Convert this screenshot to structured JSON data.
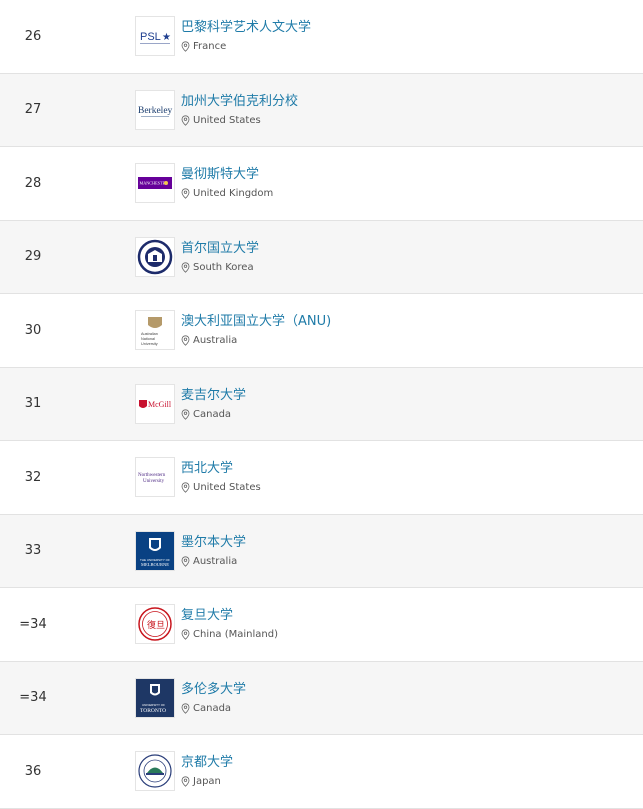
{
  "universities": [
    {
      "rank": "26",
      "name": "巴黎科学艺术人文大学",
      "country": "France",
      "logo": "psl-logo",
      "logo_text": "PSL★"
    },
    {
      "rank": "27",
      "name": "加州大学伯克利分校",
      "country": "United States",
      "logo": "berkeley-logo",
      "logo_text": "Berkeley"
    },
    {
      "rank": "28",
      "name": "曼彻斯特大学",
      "country": "United Kingdom",
      "logo": "manchester-logo",
      "logo_text": "MANCHESTER"
    },
    {
      "rank": "29",
      "name": "首尔国立大学",
      "country": "South Korea",
      "logo": "snu-logo",
      "logo_text": ""
    },
    {
      "rank": "30",
      "name": "澳大利亚国立大学（ANU)",
      "country": "Australia",
      "logo": "anu-logo",
      "logo_text": "Australian National University"
    },
    {
      "rank": "31",
      "name": "麦吉尔大学",
      "country": "Canada",
      "logo": "mcgill-logo",
      "logo_text": "McGill"
    },
    {
      "rank": "32",
      "name": "西北大学",
      "country": "United States",
      "logo": "northwestern-logo",
      "logo_text": "Northwestern University"
    },
    {
      "rank": "33",
      "name": "墨尔本大学",
      "country": "Australia",
      "logo": "melbourne-logo",
      "logo_text": "MELBOURNE"
    },
    {
      "rank": "=34",
      "name": "复旦大学",
      "country": "China (Mainland)",
      "logo": "fudan-logo",
      "logo_text": "复旦"
    },
    {
      "rank": "=34",
      "name": "多伦多大学",
      "country": "Canada",
      "logo": "toronto-logo",
      "logo_text": "TORONTO"
    },
    {
      "rank": "36",
      "name": "京都大学",
      "country": "Japan",
      "logo": "kyoto-logo",
      "logo_text": ""
    }
  ],
  "colors": {
    "link": "#1f7ba8",
    "text": "#333333",
    "alt_row": "#f6f6f6",
    "border": "#e2e2e2"
  },
  "icons": {
    "location": "location-pin-icon"
  }
}
